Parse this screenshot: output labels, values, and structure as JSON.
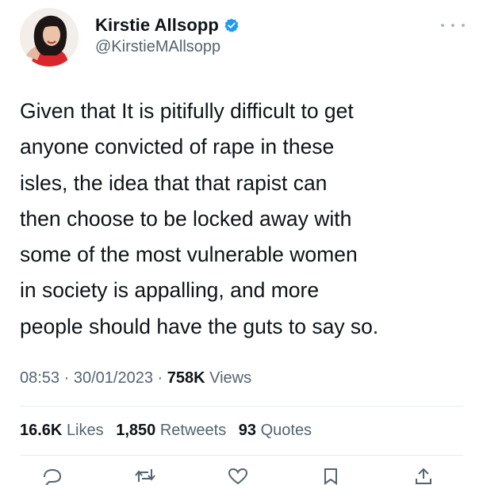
{
  "user": {
    "display_name": "Kirstie Allsopp",
    "handle": "@KirstieMAllsopp",
    "verified": true
  },
  "tweet": {
    "text": "Given that It is pitifully difficult to get\nanyone convicted of rape in these\nisles, the idea that that rapist can\nthen choose to be locked away with\nsome of the most vulnerable women\nin society is appalling, and more\npeople should have the guts to say so.",
    "time": "08:53",
    "separator": " · ",
    "date": "30/01/2023",
    "views_count": "758K",
    "views_label": "Views"
  },
  "stats": {
    "likes_count": "16.6K",
    "likes_label": "Likes",
    "retweets_count": "1,850",
    "retweets_label": "Retweets",
    "quotes_count": "93",
    "quotes_label": "Quotes"
  },
  "icons": {
    "verified": "verified-badge-icon",
    "more": "more-options-icon",
    "reply": "reply-icon",
    "retweet": "retweet-icon",
    "like": "like-icon",
    "bookmark": "bookmark-icon",
    "share": "share-icon"
  },
  "colors": {
    "accent": "#1d9bf0",
    "text": "#0f1419",
    "secondary": "#536471",
    "divider": "#e6ecf0"
  }
}
